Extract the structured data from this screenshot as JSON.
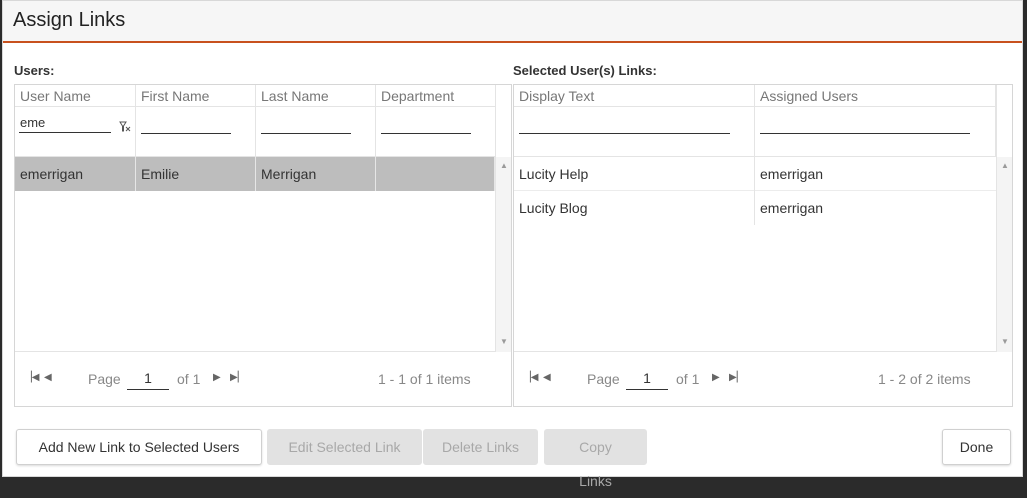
{
  "dialog": {
    "title": "Assign Links"
  },
  "users": {
    "label": "Users:",
    "columns": [
      "User Name",
      "First Name",
      "Last Name",
      "Department"
    ],
    "filters": [
      "eme",
      "",
      "",
      ""
    ],
    "rows": [
      {
        "user_name": "emerrigan",
        "first_name": "Emilie",
        "last_name": "Merrigan",
        "department": ""
      }
    ],
    "pager": {
      "page_label": "Page",
      "page": "1",
      "of_label": "of 1",
      "info": "1 - 1 of 1 items"
    }
  },
  "links": {
    "label": "Selected User(s) Links:",
    "columns": [
      "Display Text",
      "Assigned Users"
    ],
    "filters": [
      "",
      ""
    ],
    "rows": [
      {
        "display_text": "Lucity Help",
        "assigned_users": "emerrigan"
      },
      {
        "display_text": "Lucity Blog",
        "assigned_users": "emerrigan"
      }
    ],
    "pager": {
      "page_label": "Page",
      "page": "1",
      "of_label": "of 1",
      "info": "1 - 2 of 2 items"
    }
  },
  "buttons": {
    "add_new": "Add New Link to Selected Users",
    "edit": "Edit Selected Link",
    "delete": "Delete Links",
    "copy": "Copy Links",
    "done": "Done"
  },
  "icons": {
    "filter_clear": "filter-clear-icon",
    "first": "first-page-icon",
    "prev": "prev-page-icon",
    "next": "next-page-icon",
    "last": "last-page-icon",
    "scroll_up": "scroll-up-icon",
    "scroll_down": "scroll-down-icon"
  },
  "colors": {
    "accent": "#c8511e",
    "selected_row": "#bdbdbd",
    "disabled_button": "#e2e2e2"
  }
}
